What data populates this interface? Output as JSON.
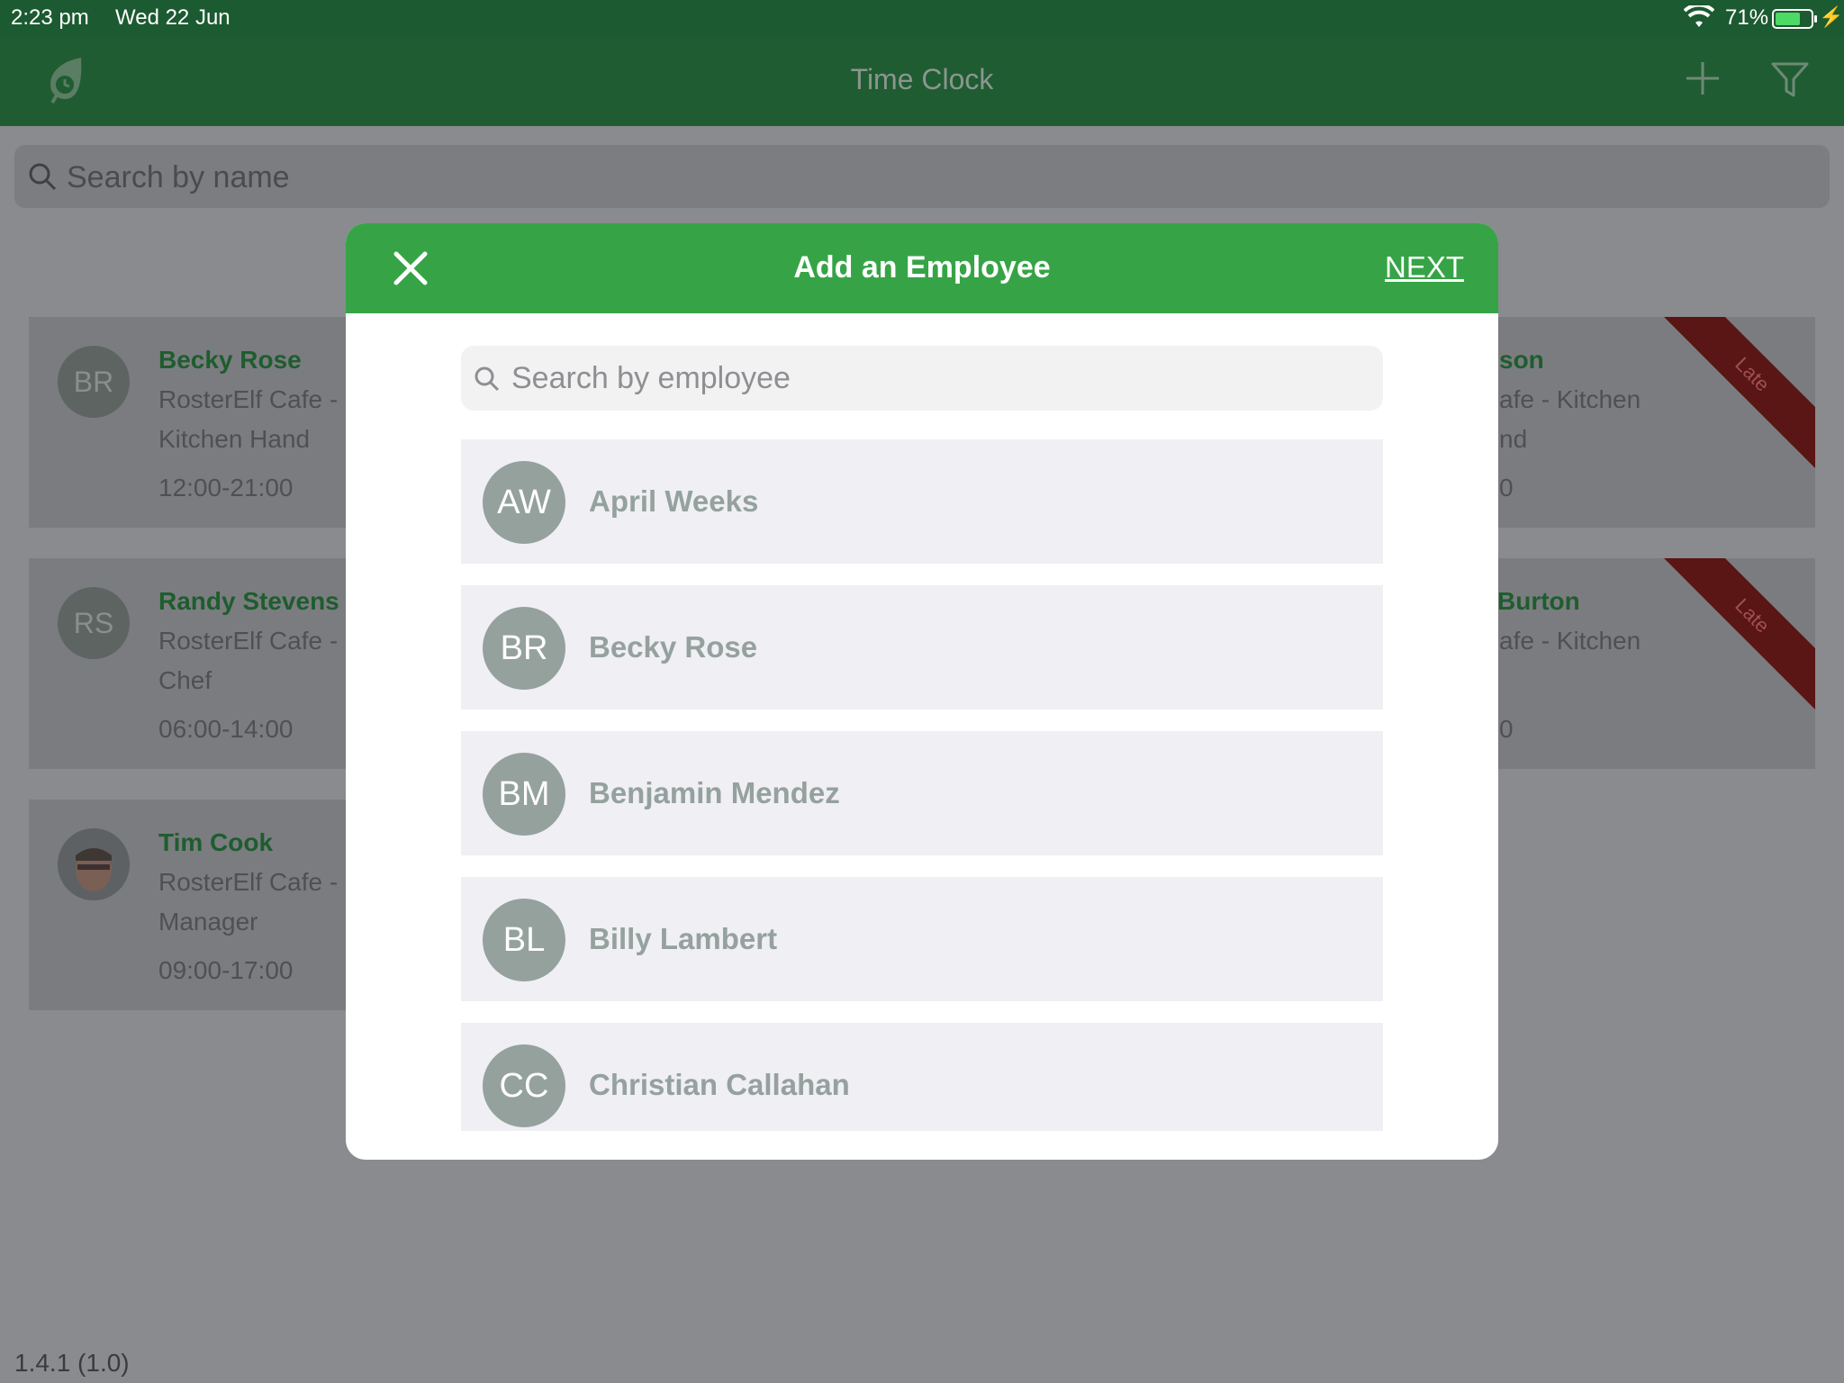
{
  "status_bar": {
    "time": "2:23 pm",
    "date": "Wed 22 Jun",
    "battery_percent": "71%",
    "battery_level": 0.71
  },
  "navbar": {
    "title": "Time Clock",
    "icons": [
      "clock-leaf-logo-icon",
      "plus-icon",
      "filter-icon"
    ]
  },
  "background": {
    "search_placeholder": "Search by name",
    "cards": [
      {
        "initials": "BR",
        "name": "Becky Rose",
        "role_line1": "RosterElf Cafe -",
        "role_line2": "Kitchen Hand",
        "hours": "12:00-21:00"
      },
      {
        "initials": "RS",
        "name": "Randy Stevens",
        "role_line1": "RosterElf Cafe -",
        "role_line2": "Chef",
        "hours": "06:00-14:00"
      },
      {
        "initials": "",
        "name": "Tim Cook",
        "role_line1": "RosterElf Cafe -",
        "role_line2": "Manager",
        "hours": "09:00-17:00"
      }
    ],
    "right_cards": [
      {
        "name_fragment": "son",
        "role_line1": "afe - Kitchen",
        "role_line2": "nd",
        "hours_fragment": "0",
        "ribbon": "Late"
      },
      {
        "name_fragment": "Burton",
        "role_line1": "afe - Kitchen",
        "role_line2": "",
        "hours_fragment": "0",
        "ribbon": "Late"
      }
    ],
    "version": "1.4.1 (1.0)"
  },
  "modal": {
    "title": "Add an Employee",
    "next_label": "NEXT",
    "search_placeholder": "Search by employee",
    "employees": [
      {
        "initials": "AW",
        "name": "April Weeks"
      },
      {
        "initials": "BR",
        "name": "Becky Rose"
      },
      {
        "initials": "BM",
        "name": "Benjamin Mendez"
      },
      {
        "initials": "BL",
        "name": "Billy Lambert"
      },
      {
        "initials": "CC",
        "name": "Christian Callahan"
      }
    ]
  },
  "colors": {
    "header_green": "#1f5c32",
    "modal_green": "#36a446",
    "name_green": "#1e5d2e",
    "late_red": "#5a1515",
    "avatar_gray": "#95a19d"
  }
}
